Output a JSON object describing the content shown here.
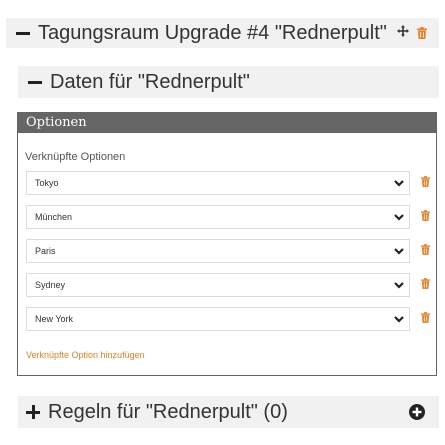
{
  "upgrade": {
    "title": "Tagungsraum Upgrade #4 \"Rednerpult\""
  },
  "data_section": {
    "title": "Daten für \"Rednerpult\""
  },
  "options_panel": {
    "heading": "Optionen",
    "linked_label": "Verknüpfte Optionen",
    "rows": [
      {
        "value": "Tokyo"
      },
      {
        "value": "München"
      },
      {
        "value": "Paris"
      },
      {
        "value": "Sydney"
      },
      {
        "value": "New York"
      }
    ],
    "add_link": "Verknüpfte Option hinzufügen"
  },
  "rules_section": {
    "title": "Regeln für \"Rednerpult\" (0)"
  },
  "colors": {
    "accent": "#e67e22",
    "panel_header": "#666666",
    "section_bg": "#f1f1f1"
  },
  "icons": [
    "minus-icon",
    "move-icon",
    "trash-icon",
    "chevron-down-icon",
    "plus-icon",
    "add-circle-icon"
  ]
}
